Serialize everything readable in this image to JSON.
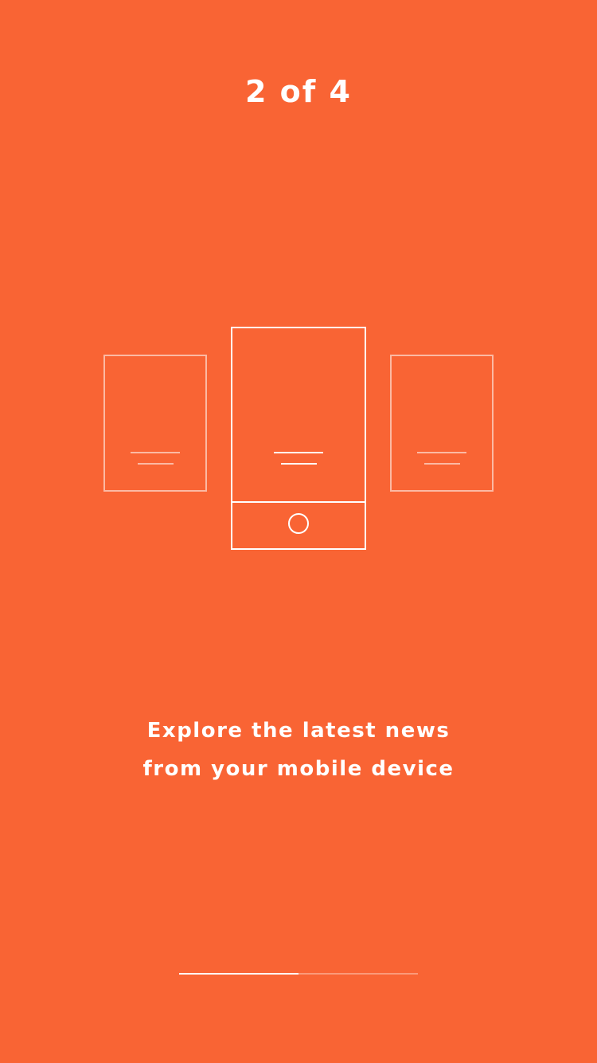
{
  "onboarding": {
    "step_label": "2 of 4",
    "current_step": 2,
    "total_steps": 4,
    "message_line1": "Explore the latest news",
    "message_line2": "from your mobile device",
    "progress_fraction": 0.5
  },
  "colors": {
    "background": "#F96434",
    "foreground": "#FFFFFF"
  },
  "icons": {
    "left_card": "page-card-outline-icon",
    "center_phone": "phone-outline-icon",
    "right_card": "page-card-outline-icon",
    "home_button": "circle-home-button-icon"
  }
}
